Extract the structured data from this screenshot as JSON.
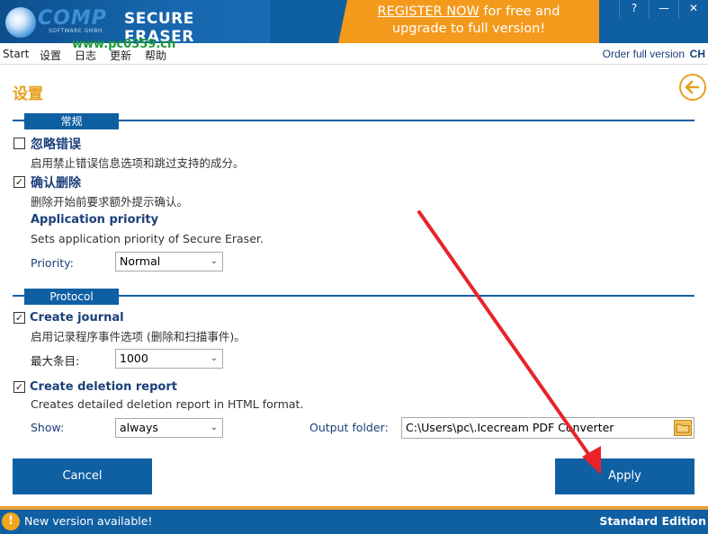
{
  "header": {
    "logo_main": "COMP",
    "logo_sub": "SOFTWARE GMBH",
    "app_title": "SECURE ERASER",
    "watermark": "www.pc0359.cn",
    "register_line1_link": "REGISTER NOW",
    "register_line1_rest": " for free and",
    "register_line2": "upgrade to full version!",
    "window_buttons": [
      "?",
      "—",
      "✕"
    ]
  },
  "menu": {
    "items": [
      "Start",
      "设置",
      "日志",
      "更新",
      "帮助"
    ],
    "order_full_version": "Order full version",
    "language": "CH"
  },
  "page": {
    "title": "设置"
  },
  "general": {
    "section_label": "常规",
    "ignore_errors": {
      "checked": false,
      "title": "忽略错误",
      "desc": "启用禁止错误信息选项和跳过支持的成分。"
    },
    "confirm_delete": {
      "checked": true,
      "title": "确认删除",
      "desc": "删除开始前要求额外提示确认。"
    },
    "priority": {
      "title": "Application priority",
      "desc": "Sets application priority of Secure Eraser.",
      "label": "Priority:",
      "value": "Normal"
    }
  },
  "protocol": {
    "section_label": "Protocol",
    "create_journal": {
      "checked": true,
      "title": "Create journal",
      "desc": "启用记录程序事件选项 (删除和扫描事件)。"
    },
    "max_entries": {
      "label": "最大条目:",
      "value": "1000"
    },
    "deletion_report": {
      "checked": true,
      "title": "Create deletion report",
      "desc": "Creates detailed deletion report in HTML format."
    },
    "show": {
      "label": "Show:",
      "value": "always"
    },
    "output_folder": {
      "label": "Output folder:",
      "value": "C:\\Users\\pc\\.Icecream PDF Converter"
    }
  },
  "buttons": {
    "cancel": "Cancel",
    "apply": "Apply"
  },
  "status": {
    "warning_symbol": "!",
    "message": "New version available!",
    "edition": "Standard Edition"
  },
  "colors": {
    "primary": "#0f5fa3",
    "accent": "#e8a020",
    "register_bg": "#f39a1c",
    "annotation_arrow": "#e8232a"
  }
}
